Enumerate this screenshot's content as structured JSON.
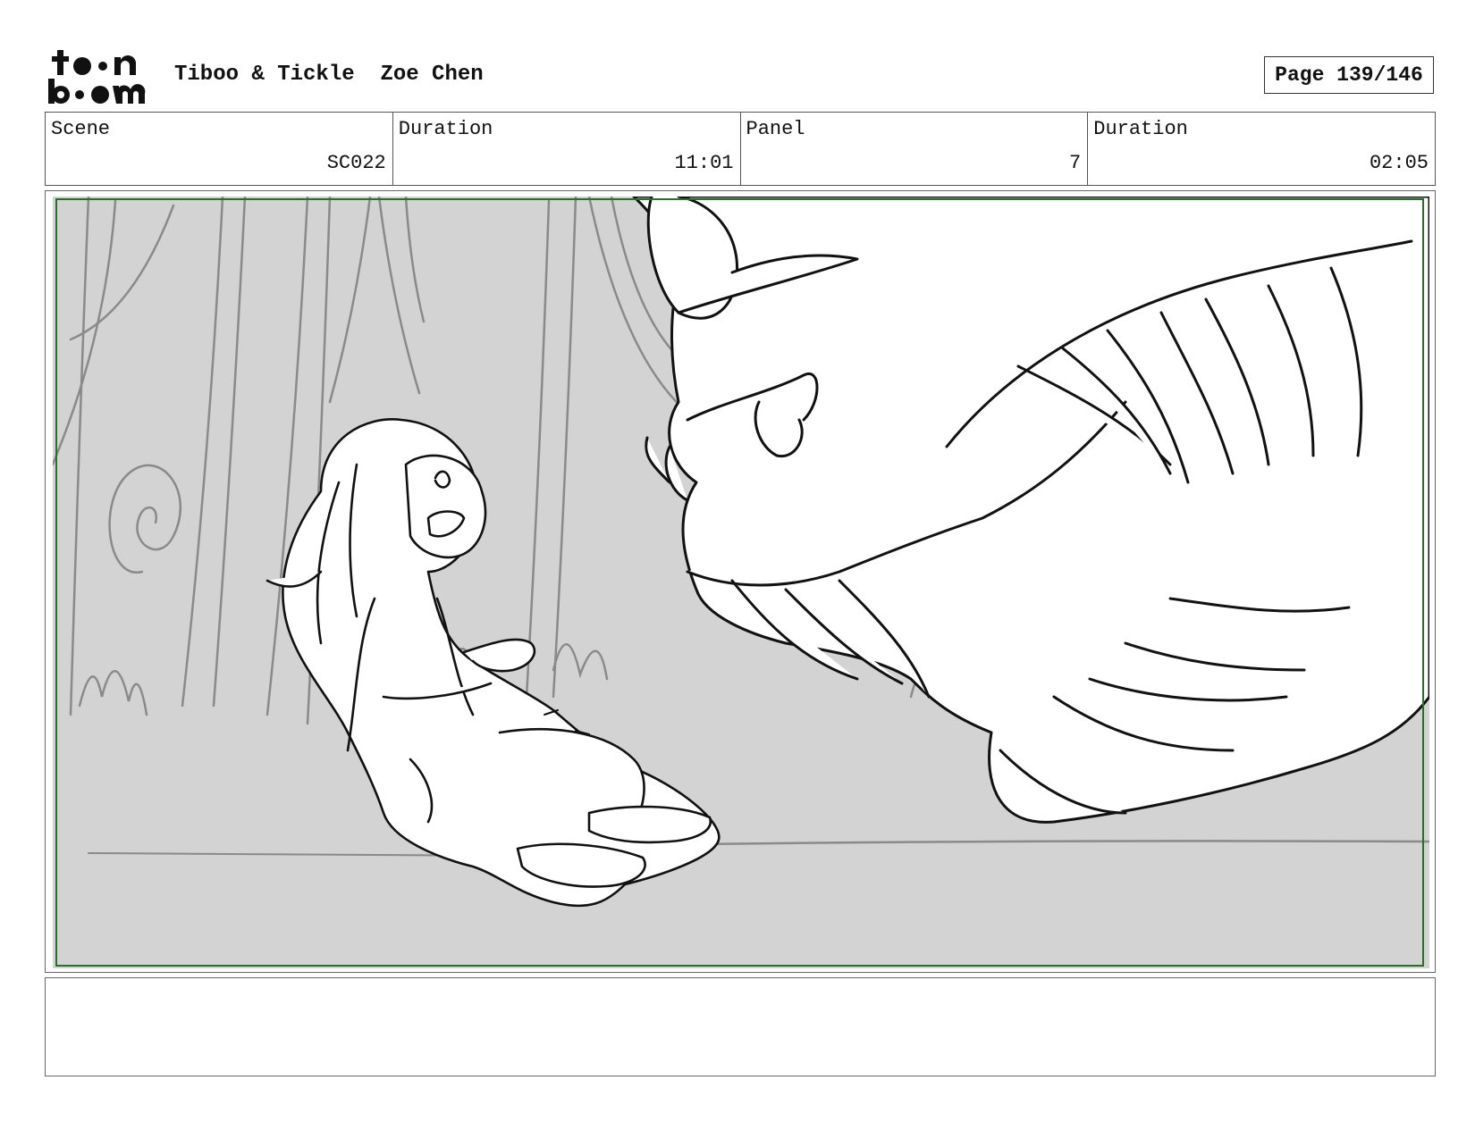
{
  "header": {
    "logo_text": "toon boom",
    "project_title": "Tiboo & Tickle  Zoe Chen",
    "page_label": "Page 139/146"
  },
  "info": [
    {
      "label": "Scene",
      "value": "SC022"
    },
    {
      "label": "Duration",
      "value": "11:01"
    },
    {
      "label": "Panel",
      "value": "7"
    },
    {
      "label": "Duration",
      "value": "02:05"
    }
  ],
  "notes": {
    "text": ""
  },
  "colors": {
    "safe_frame": "#2a6e2a",
    "panel_background": "#d3d3d3"
  }
}
